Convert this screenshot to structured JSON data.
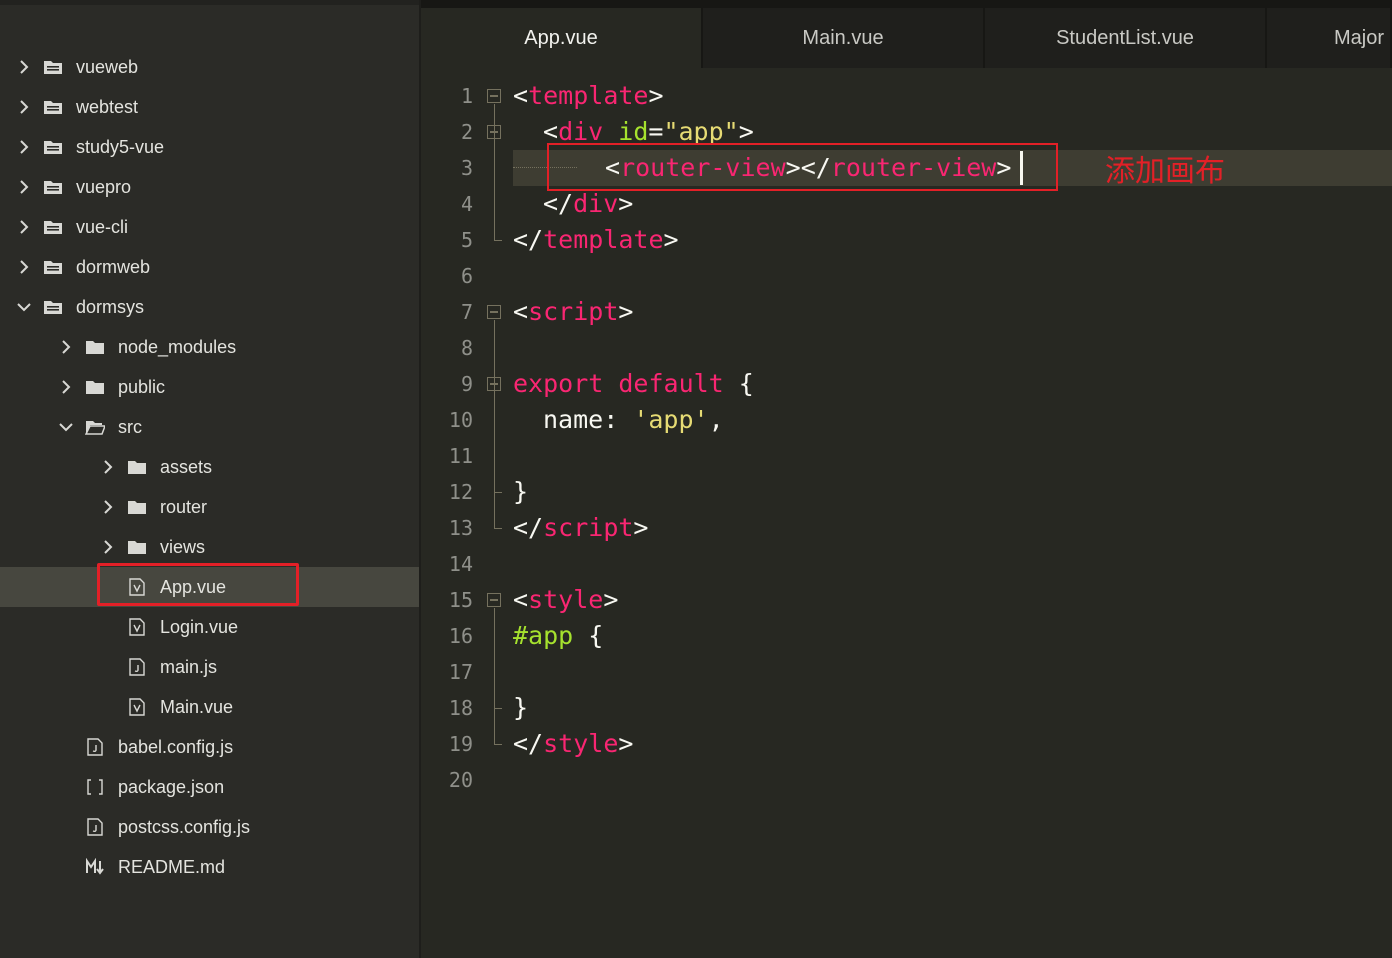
{
  "sidebar": {
    "items": [
      {
        "label": "vueweb",
        "type": "folder",
        "expanded": false
      },
      {
        "label": "webtest",
        "type": "folder",
        "expanded": false
      },
      {
        "label": "study5-vue",
        "type": "folder",
        "expanded": false
      },
      {
        "label": "vuepro",
        "type": "folder",
        "expanded": false
      },
      {
        "label": "vue-cli",
        "type": "folder",
        "expanded": false
      },
      {
        "label": "dormweb",
        "type": "folder",
        "expanded": false
      },
      {
        "label": "dormsys",
        "type": "folder",
        "expanded": true
      },
      {
        "label": "node_modules",
        "type": "folder",
        "expanded": false
      },
      {
        "label": "public",
        "type": "folder",
        "expanded": false
      },
      {
        "label": "src",
        "type": "folder",
        "expanded": true
      },
      {
        "label": "assets",
        "type": "folder",
        "expanded": false
      },
      {
        "label": "router",
        "type": "folder",
        "expanded": false
      },
      {
        "label": "views",
        "type": "folder",
        "expanded": false
      },
      {
        "label": "App.vue",
        "type": "vue-file",
        "selected": true
      },
      {
        "label": "Login.vue",
        "type": "vue-file"
      },
      {
        "label": "main.js",
        "type": "js-file"
      },
      {
        "label": "Main.vue",
        "type": "vue-file"
      },
      {
        "label": "babel.config.js",
        "type": "js-file"
      },
      {
        "label": "package.json",
        "type": "json-file"
      },
      {
        "label": "postcss.config.js",
        "type": "js-file"
      },
      {
        "label": "README.md",
        "type": "markdown-file"
      }
    ]
  },
  "tabs": [
    {
      "label": "App.vue",
      "active": true
    },
    {
      "label": "Main.vue",
      "active": false
    },
    {
      "label": "StudentList.vue",
      "active": false
    },
    {
      "label": "Major",
      "active": false
    }
  ],
  "editor": {
    "line_numbers": [
      "1",
      "2",
      "3",
      "4",
      "5",
      "6",
      "7",
      "8",
      "9",
      "10",
      "11",
      "12",
      "13",
      "14",
      "15",
      "16",
      "17",
      "18",
      "19",
      "20"
    ],
    "current_line": "3",
    "code": {
      "l1": {
        "p1": "<",
        "p2": "template",
        "p3": ">"
      },
      "l2": {
        "p1": "<",
        "p2": "div",
        "p3": " ",
        "p4": "id",
        "p5": "=",
        "p6": "\"app\"",
        "p7": ">"
      },
      "l3": {
        "p1": "<",
        "p2": "router-view",
        "p3": "></",
        "p4": "router-view",
        "p5": ">"
      },
      "l4": {
        "p1": "</",
        "p2": "div",
        "p3": ">"
      },
      "l5": {
        "p1": "</",
        "p2": "template",
        "p3": ">"
      },
      "l7": {
        "p1": "<",
        "p2": "script",
        "p3": ">"
      },
      "l9": {
        "p1": "export",
        "p2": " ",
        "p3": "default",
        "p4": " {"
      },
      "l10": {
        "p1": "name: ",
        "p2": "'app'",
        "p3": ","
      },
      "l12": {
        "p1": "}"
      },
      "l13": {
        "p1": "</",
        "p2": "script",
        "p3": ">"
      },
      "l15": {
        "p1": "<",
        "p2": "style",
        "p3": ">"
      },
      "l16": {
        "p1": "#app",
        "p2": " {"
      },
      "l18": {
        "p1": "}"
      },
      "l19": {
        "p1": "</",
        "p2": "style",
        "p3": ">"
      }
    }
  },
  "annotation": {
    "text": "添加画布",
    "color": "#e32027"
  },
  "colors": {
    "tag": "#f92672",
    "attr": "#a6e22e",
    "string": "#e6db74",
    "highlight_box": "#e32027"
  }
}
